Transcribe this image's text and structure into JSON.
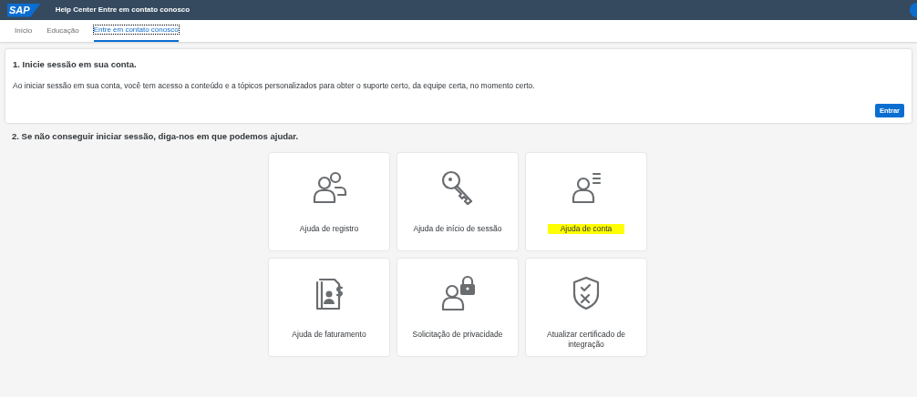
{
  "header": {
    "logo": "SAP",
    "title": "Help Center Entre em contato conosco"
  },
  "tabs": [
    {
      "label": "Início",
      "selected": false
    },
    {
      "label": "Educação",
      "selected": false
    },
    {
      "label": "Entre em contato conosco",
      "selected": true
    }
  ],
  "signin": {
    "heading": "1. Inicie sessão em sua conta.",
    "text": "Ao iniciar sessão em sua conta, você tem acesso a conteúdo e a tópicos personalizados para obter o suporte certo, da equipe certa, no momento certo.",
    "button": "Entrar"
  },
  "help": {
    "heading": "2. Se não conseguir iniciar sessão, diga-nos em que podemos ajudar.",
    "tiles": [
      {
        "kind": "users",
        "label": "Ajuda de registro",
        "highlighted": false
      },
      {
        "kind": "key",
        "label": "Ajuda de início de sessão",
        "highlighted": false
      },
      {
        "kind": "user-list",
        "label": "Ajuda de conta",
        "highlighted": true
      },
      {
        "kind": "invoice",
        "label": "Ajuda de faturamento",
        "highlighted": false
      },
      {
        "kind": "user-lock",
        "label": "Solicitação de privacidade",
        "highlighted": false
      },
      {
        "kind": "shield",
        "label": "Atualizar certificado de integração",
        "highlighted": false
      }
    ]
  }
}
